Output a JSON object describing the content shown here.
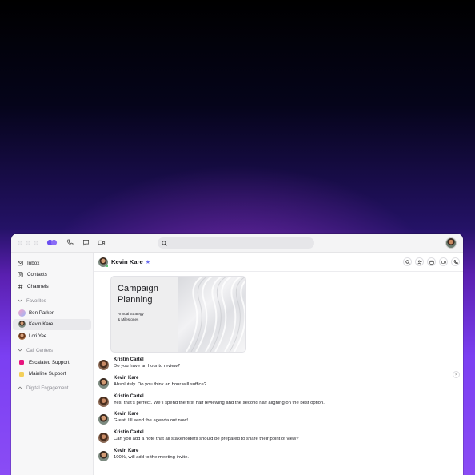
{
  "sidebar": {
    "nav": [
      {
        "label": "Inbox",
        "icon": "inbox-icon"
      },
      {
        "label": "Contacts",
        "icon": "contacts-icon"
      },
      {
        "label": "Channels",
        "icon": "hash-icon"
      }
    ],
    "favorites_label": "Favorites",
    "favorites": [
      {
        "label": "Ben Parker"
      },
      {
        "label": "Kevin Kare"
      },
      {
        "label": "Lori Yee"
      }
    ],
    "call_centers_label": "Call Centers",
    "call_centers": [
      {
        "label": "Escalated Support",
        "color": "#e8157f"
      },
      {
        "label": "Mainline Support",
        "color": "#f3cf5a"
      }
    ],
    "digital_engagement_label": "Digital Engagement"
  },
  "header": {
    "contact_name": "Kevin Kare",
    "star": "★"
  },
  "card": {
    "title": "Campaign Planning",
    "subtitle": "Annual Strategy\n& Milestones"
  },
  "messages": [
    {
      "sender": "Kristin Cartel",
      "text": "Do you have an hour to review?"
    },
    {
      "sender": "Kevin Kare",
      "text": "Absolutely. Do you think an hour will suffice?"
    },
    {
      "sender": "Kristin Cartel",
      "text": "Yes, that’s perfect. We’ll spend the first half reviewing and the second half aligning on the best option."
    },
    {
      "sender": "Kevin Kare",
      "text": "Great, I’ll send the agenda out now!"
    },
    {
      "sender": "Kristin Cartel",
      "text": "Can you add a note that all stakeholders should be prepared to share their point of view?"
    },
    {
      "sender": "Kevin Kare",
      "text": "100%, will add to the meeting invite."
    }
  ],
  "close_glyph": "×",
  "colors": {
    "accent": "#6b6ef0",
    "online": "#2fb34a",
    "brand_logo": "#6b4ff0"
  }
}
